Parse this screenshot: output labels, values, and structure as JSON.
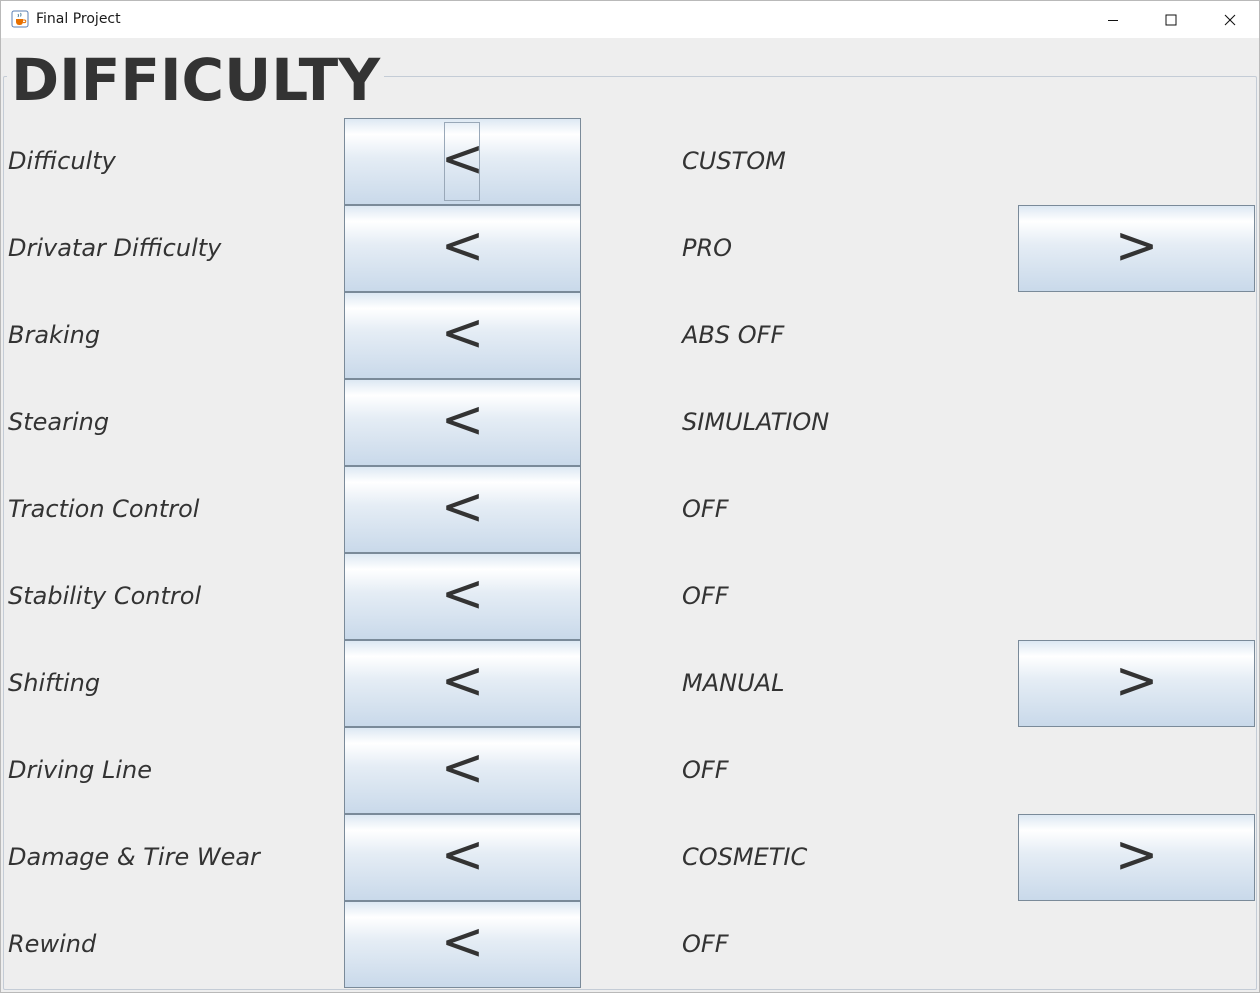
{
  "window": {
    "title": "Final Project",
    "icon": "java-cup-icon"
  },
  "heading": "DIFFICULTY",
  "controls": {
    "prev_label": "<",
    "next_label": ">"
  },
  "settings": [
    {
      "label": "Difficulty",
      "value": "CUSTOM",
      "has_next": false
    },
    {
      "label": "Drivatar Difficulty",
      "value": "PRO",
      "has_next": true
    },
    {
      "label": "Braking",
      "value": "ABS OFF",
      "has_next": false
    },
    {
      "label": "Stearing",
      "value": "SIMULATION",
      "has_next": false
    },
    {
      "label": "Traction Control",
      "value": "OFF",
      "has_next": false
    },
    {
      "label": "Stability Control",
      "value": "OFF",
      "has_next": false
    },
    {
      "label": "Shifting",
      "value": "MANUAL",
      "has_next": true
    },
    {
      "label": "Driving Line",
      "value": "OFF",
      "has_next": false
    },
    {
      "label": "Damage & Tire Wear",
      "value": "COSMETIC",
      "has_next": true
    },
    {
      "label": "Rewind",
      "value": "OFF",
      "has_next": false
    }
  ],
  "colors": {
    "background": "#eeeeee",
    "text": "#333333",
    "button_border": "#7a8a99",
    "button_gradient_bottom": "#c9d9ea"
  }
}
